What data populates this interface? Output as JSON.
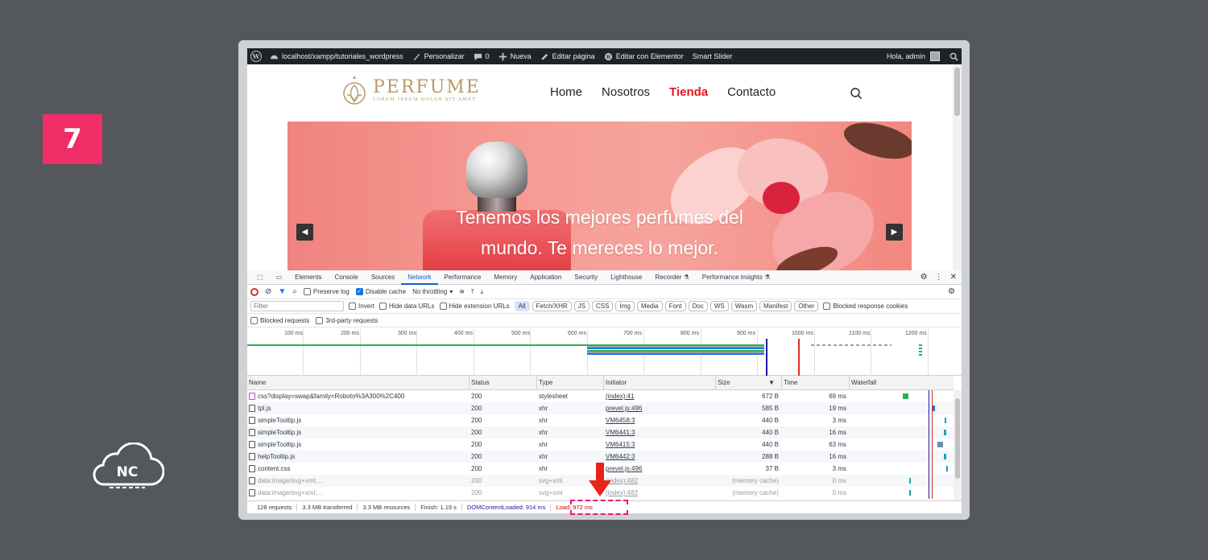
{
  "step": {
    "number": "7"
  },
  "brand": {
    "logo_text": "NC",
    "accent": "#f02e67"
  },
  "adminbar": {
    "site": "localhost/xampp/tutoriales_wordpress",
    "customize": "Personalizar",
    "comments_count": "0",
    "new": "Nueva",
    "edit_page": "Editar página",
    "edit_elementor": "Editar con Elementor",
    "smart_slider": "Smart Slider",
    "greeting": "Hola, admin"
  },
  "site": {
    "logo_title": "PERFUME",
    "logo_subtitle": "LOREM IPSUM DOLOR SIT AMET",
    "nav": [
      "Home",
      "Nosotros",
      "Tienda",
      "Contacto"
    ],
    "nav_active_color": "#e3141f",
    "slide_text_line1": "Tenemos los mejores perfumes del",
    "slide_text_line2": "mundo. Te mereces lo mejor."
  },
  "devtools": {
    "tabs": [
      "Elements",
      "Console",
      "Sources",
      "Network",
      "Performance",
      "Memory",
      "Application",
      "Security",
      "Lighthouse",
      "Recorder ⚗",
      "Performance insights ⚗"
    ],
    "active_tab": "Network",
    "toolbar": {
      "preserve_log": "Preserve log",
      "disable_cache": "Disable cache",
      "throttling": "No throttling"
    },
    "filter": {
      "placeholder": "Filter",
      "invert": "Invert",
      "hide_data_urls": "Hide data URLs",
      "hide_extension_urls": "Hide extension URLs",
      "types": [
        "All",
        "Fetch/XHR",
        "JS",
        "CSS",
        "Img",
        "Media",
        "Font",
        "Doc",
        "WS",
        "Wasm",
        "Manifest",
        "Other"
      ],
      "blocked_cookies": "Blocked response cookies",
      "blocked_requests": "Blocked requests",
      "third_party": "3rd-party requests"
    },
    "timeline_ticks": [
      "100 ms",
      "200 ms",
      "300 ms",
      "400 ms",
      "500 ms",
      "600 ms",
      "700 ms",
      "800 ms",
      "900 ms",
      "1000 ms",
      "1100 ms",
      "1200 ms"
    ],
    "columns": [
      "Name",
      "Status",
      "Type",
      "Initiator",
      "Size",
      "Time",
      "Waterfall"
    ],
    "rows": [
      {
        "name": "css?display=swap&family=Roboto%3A300%2C400",
        "status": "200",
        "type": "stylesheet",
        "initiator": "(index):41",
        "size": "672 B",
        "time": "69 ms",
        "faded": false
      },
      {
        "name": "tpl.js",
        "status": "200",
        "type": "xhr",
        "initiator": "prevel.js:496",
        "size": "585 B",
        "time": "19 ms",
        "faded": false
      },
      {
        "name": "simpleTooltip.js",
        "status": "200",
        "type": "xhr",
        "initiator": "VM6458:3",
        "size": "440 B",
        "time": "3 ms",
        "faded": false
      },
      {
        "name": "simpleTooltip.js",
        "status": "200",
        "type": "xhr",
        "initiator": "VM6441:3",
        "size": "440 B",
        "time": "16 ms",
        "faded": false
      },
      {
        "name": "simpleTooltip.js",
        "status": "200",
        "type": "xhr",
        "initiator": "VM6415:3",
        "size": "440 B",
        "time": "63 ms",
        "faded": false
      },
      {
        "name": "helpTooltip.js",
        "status": "200",
        "type": "xhr",
        "initiator": "VM6442:3",
        "size": "288 B",
        "time": "16 ms",
        "faded": false
      },
      {
        "name": "content.css",
        "status": "200",
        "type": "xhr",
        "initiator": "prevel.js:496",
        "size": "37 B",
        "time": "3 ms",
        "faded": false
      },
      {
        "name": "data:image/svg+xml;...",
        "status": "200",
        "type": "svg+xml",
        "initiator": "(index):482",
        "size": "(memory cache)",
        "time": "0 ms",
        "faded": true
      },
      {
        "name": "data:image/svg+xml;...",
        "status": "200",
        "type": "svg+xml",
        "initiator": "(index):482",
        "size": "(memory cache)",
        "time": "0 ms",
        "faded": true
      }
    ],
    "status": {
      "requests": "128 requests",
      "transferred": "3.3 MB transferred",
      "resources": "3.3 MB resources",
      "finish": "Finish: 1.19 s",
      "dom_content_loaded": "DOMContentLoaded: 914 ms",
      "load": "Load: 972 ms"
    }
  }
}
